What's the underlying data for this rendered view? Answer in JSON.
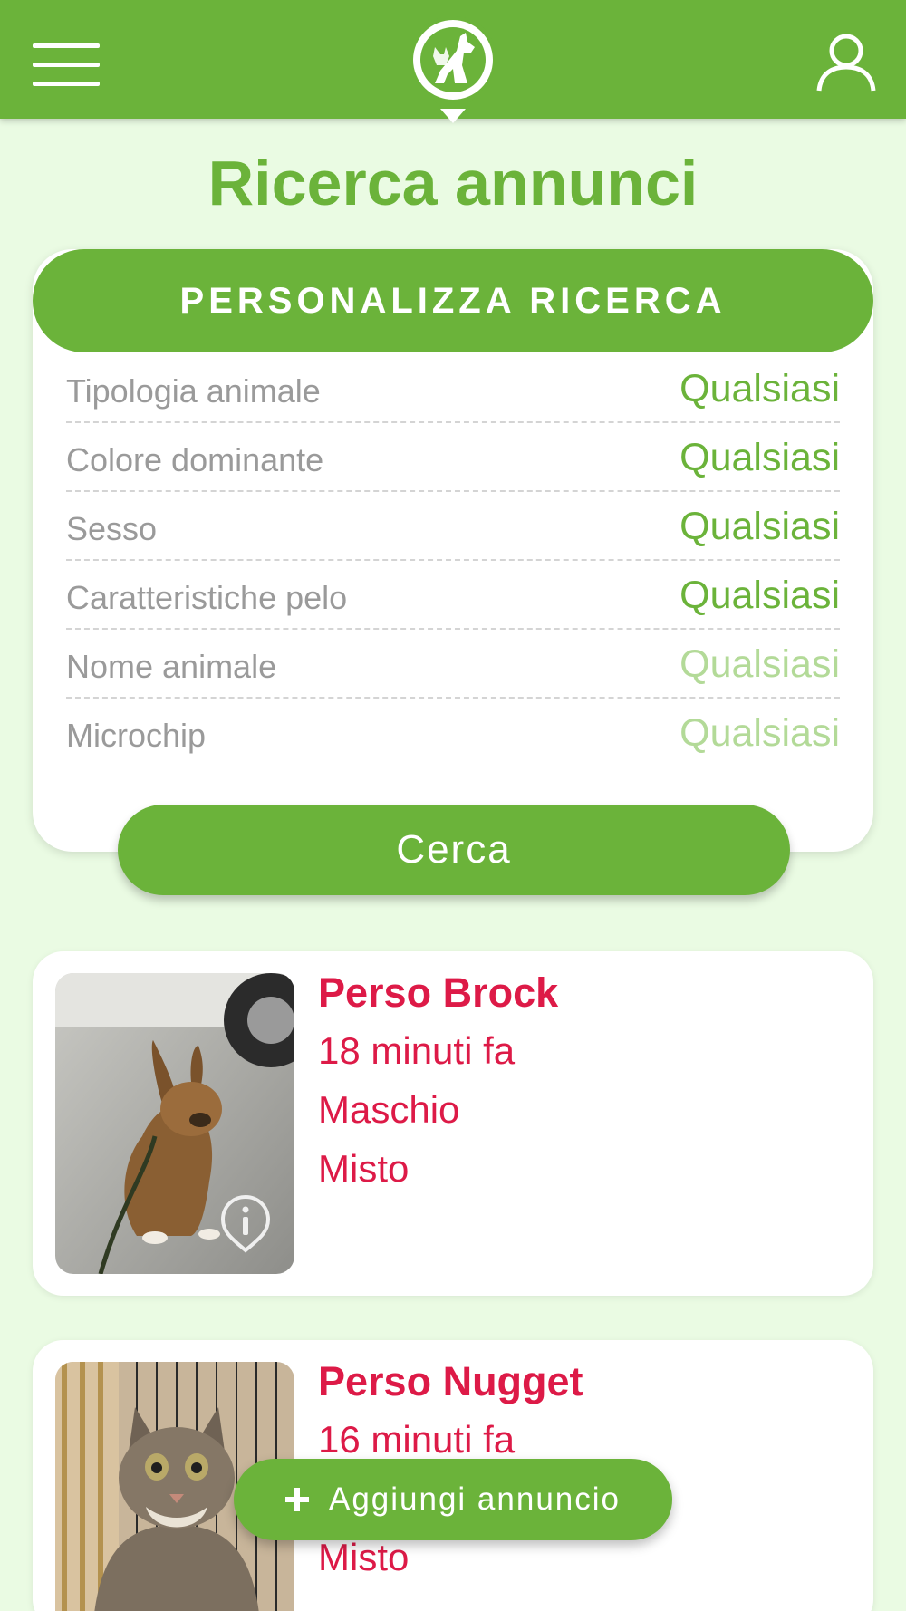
{
  "colors": {
    "brand_green": "#6bb33a",
    "background": "#eafbe3",
    "listing_red": "#dd1a47"
  },
  "header": {
    "menu_icon": "hamburger-menu-icon",
    "logo_icon": "pet-location-pin-logo",
    "user_icon": "user-profile-icon"
  },
  "page": {
    "title": "Ricerca annunci"
  },
  "search": {
    "header": "PERSONALIZZA RICERCA",
    "filters": [
      {
        "label": "Tipologia animale",
        "value": "Qualsiasi"
      },
      {
        "label": "Colore dominante",
        "value": "Qualsiasi"
      },
      {
        "label": "Sesso",
        "value": "Qualsiasi"
      },
      {
        "label": "Caratteristiche pelo",
        "value": "Qualsiasi"
      },
      {
        "label": "Nome animale",
        "value": "Qualsiasi"
      },
      {
        "label": "Microchip",
        "value": "Qualsiasi"
      }
    ],
    "button": "Cerca"
  },
  "listings": [
    {
      "title": "Perso Brock",
      "time": "18 minuti fa",
      "sex": "Maschio",
      "breed": "Misto"
    },
    {
      "title": "Perso Nugget",
      "time": "16 minuti fa",
      "sex": "",
      "breed": "Misto"
    }
  ],
  "fab": {
    "label": "Aggiungi annuncio",
    "icon": "plus-icon"
  }
}
